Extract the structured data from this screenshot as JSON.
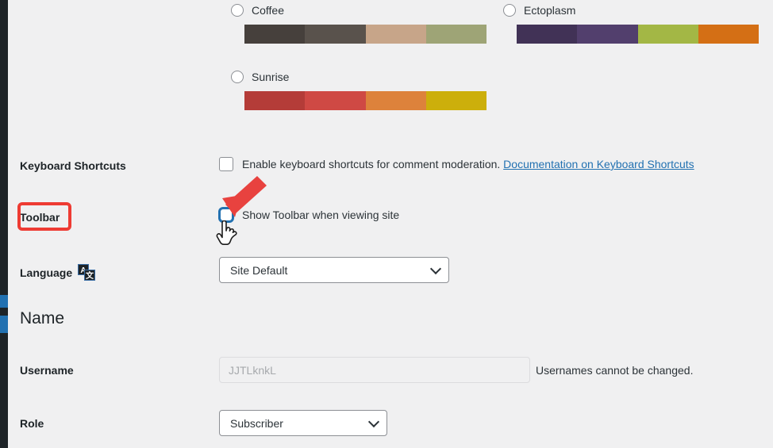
{
  "color_schemes": [
    {
      "name": "Coffee",
      "selected": false,
      "colors": [
        "#46403c",
        "#59524c",
        "#c7a589",
        "#9ea476"
      ]
    },
    {
      "name": "Ectoplasm",
      "selected": false,
      "colors": [
        "#413256",
        "#523f6d",
        "#a3b745",
        "#d46f15"
      ]
    },
    {
      "name": "Sunrise",
      "selected": false,
      "colors": [
        "#b43c38",
        "#cf4944",
        "#dd823b",
        "#ccaf0b"
      ]
    }
  ],
  "keyboard_shortcuts": {
    "label": "Keyboard Shortcuts",
    "checkbox_text": "Enable keyboard shortcuts for comment moderation.",
    "link_text": "Documentation on Keyboard Shortcuts",
    "checked": false
  },
  "toolbar": {
    "label": "Toolbar",
    "checkbox_text": "Show Toolbar when viewing site",
    "checked": false,
    "focused": true
  },
  "language": {
    "label": "Language",
    "icon": "translation-icon",
    "value": "Site Default"
  },
  "name_section": {
    "heading": "Name"
  },
  "username": {
    "label": "Username",
    "value": "JJTLknkL",
    "note": "Usernames cannot be changed.",
    "disabled": true
  },
  "role": {
    "label": "Role",
    "value": "Subscriber"
  },
  "annotations": {
    "highlight_color": "#ee3b33",
    "arrow_color": "#e8423f",
    "focus_color": "#2271b1"
  },
  "colors": {
    "page_background": "#f0f0f1",
    "sidebar": "#1d2327",
    "sidebar_active": "#2271b1",
    "link": "#2271b1",
    "text": "#1d2327"
  }
}
